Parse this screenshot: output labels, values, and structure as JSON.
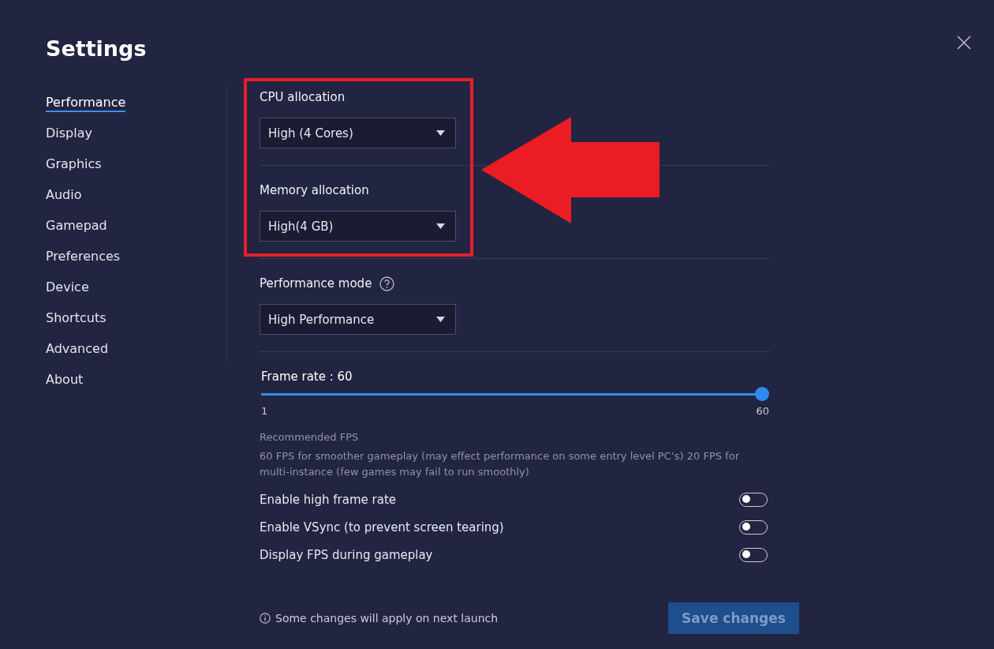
{
  "window": {
    "title": "Settings"
  },
  "sidebar": {
    "items": [
      {
        "label": "Performance",
        "selected": true
      },
      {
        "label": "Display",
        "selected": false
      },
      {
        "label": "Graphics",
        "selected": false
      },
      {
        "label": "Audio",
        "selected": false
      },
      {
        "label": "Gamepad",
        "selected": false
      },
      {
        "label": "Preferences",
        "selected": false
      },
      {
        "label": "Device",
        "selected": false
      },
      {
        "label": "Shortcuts",
        "selected": false
      },
      {
        "label": "Advanced",
        "selected": false
      },
      {
        "label": "About",
        "selected": false
      }
    ]
  },
  "dropdowns": [
    {
      "label": "CPU allocation",
      "value": "High (4 Cores)",
      "help": false
    },
    {
      "label": "Memory allocation",
      "value": "High(4 GB)",
      "help": false
    },
    {
      "label": "Performance mode",
      "value": "High Performance",
      "help": true
    }
  ],
  "frame_rate": {
    "label": "Frame rate : 60",
    "level": 1,
    "min": "1",
    "max": "60"
  },
  "recommended": {
    "title": "Recommended FPS",
    "text": "60 FPS for smoother gameplay (may effect performance on some entry level PC’s) 20 FPS for multi-instance (few games may fail to run smoothly)"
  },
  "toggles": [
    {
      "label": "Enable high frame rate",
      "on": false
    },
    {
      "label": "Enable VSync (to prevent screen tearing)",
      "on": false
    },
    {
      "label": "Display FPS during gameplay",
      "on": false
    }
  ],
  "footer": {
    "note": "Some changes will apply on next launch",
    "save_button": {
      "label": "Save changes",
      "disabled": true
    }
  }
}
